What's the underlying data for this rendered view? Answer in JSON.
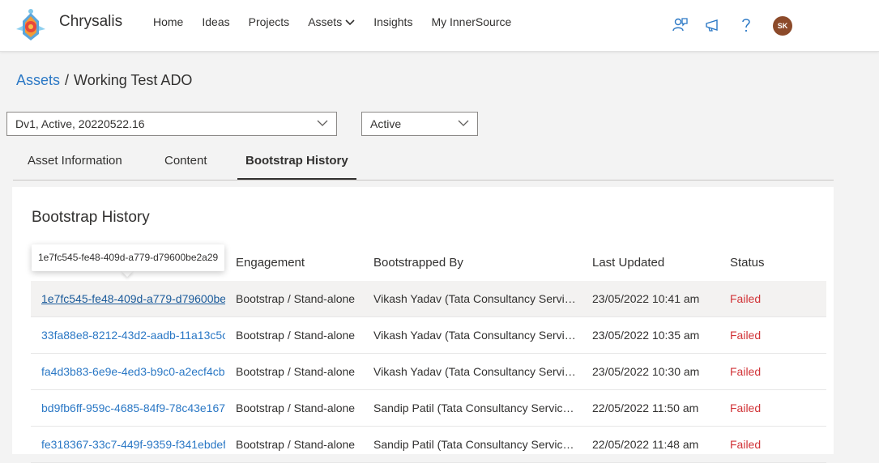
{
  "header": {
    "brand": "Chrysalis",
    "nav": [
      {
        "label": "Home"
      },
      {
        "label": "Ideas"
      },
      {
        "label": "Projects"
      },
      {
        "label": "Assets",
        "has_dropdown": true
      },
      {
        "label": "Insights"
      },
      {
        "label": "My InnerSource"
      }
    ],
    "icons": [
      "feedback-icon",
      "announcement-icon",
      "help-icon"
    ],
    "avatar_initials": "SK"
  },
  "breadcrumb": {
    "link": "Assets",
    "separator": "/",
    "current": "Working Test ADO"
  },
  "filters": {
    "version_select": "Dv1, Active, 20220522.16",
    "status_select": "Active"
  },
  "tabs": [
    {
      "label": "Asset Information",
      "active": false
    },
    {
      "label": "Content",
      "active": false
    },
    {
      "label": "Bootstrap History",
      "active": true
    }
  ],
  "section": {
    "title": "Bootstrap History",
    "columns": [
      "Engagement",
      "Bootstrapped By",
      "Last Updated",
      "Status"
    ],
    "rows": [
      {
        "id": "1e7fc545-fe48-409d-a779-d79600be",
        "engagement": "Bootstrap / Stand-alone",
        "by": "Vikash Yadav (Tata Consultancy Service...",
        "updated": "23/05/2022 10:41 am",
        "status": "Failed"
      },
      {
        "id": "33fa88e8-8212-43d2-aadb-11a13c5c",
        "engagement": "Bootstrap / Stand-alone",
        "by": "Vikash Yadav (Tata Consultancy Service...",
        "updated": "23/05/2022 10:35 am",
        "status": "Failed"
      },
      {
        "id": "fa4d3b83-6e9e-4ed3-b9c0-a2ecf4cb!",
        "engagement": "Bootstrap / Stand-alone",
        "by": "Vikash Yadav (Tata Consultancy Service...",
        "updated": "23/05/2022 10:30 am",
        "status": "Failed"
      },
      {
        "id": "bd9fb6ff-959c-4685-84f9-78c43e167",
        "engagement": "Bootstrap / Stand-alone",
        "by": "Sandip Patil (Tata Consultancy Services...",
        "updated": "22/05/2022 11:50 am",
        "status": "Failed"
      },
      {
        "id": "fe318367-33c7-449f-9359-f341ebdef",
        "engagement": "Bootstrap / Stand-alone",
        "by": "Sandip Patil (Tata Consultancy Services...",
        "updated": "22/05/2022 11:48 am",
        "status": "Failed"
      }
    ]
  },
  "tooltip": "1e7fc545-fe48-409d-a779-d79600be2a29",
  "colors": {
    "link": "#2b78c5",
    "status_failed": "#d13438",
    "avatar_bg": "#8c4a2a"
  }
}
